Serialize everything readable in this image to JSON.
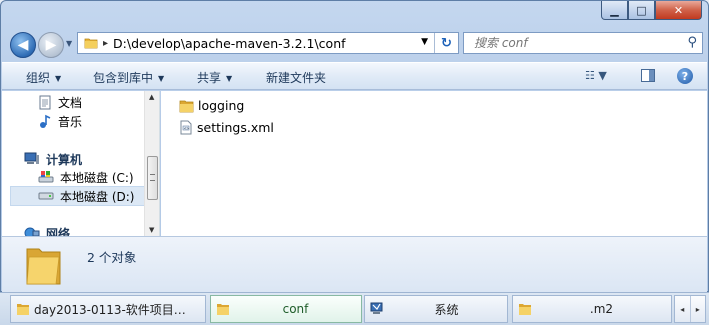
{
  "window": {
    "minimize_glyph": "▁",
    "maximize_glyph": "□",
    "close_glyph": "✕"
  },
  "address": {
    "path": "D:\\develop\\apache-maven-3.2.1\\conf",
    "search_placeholder": "搜索 conf"
  },
  "toolbar": {
    "organize": "组织",
    "include_in_library": "包含到库中",
    "share": "共享",
    "new_folder": "新建文件夹"
  },
  "navpane": {
    "items": [
      {
        "label": "文档",
        "icon": "documents-icon"
      },
      {
        "label": "音乐",
        "icon": "music-icon"
      },
      {
        "label": "计算机",
        "icon": "computer-icon"
      },
      {
        "label": "本地磁盘 (C:)",
        "icon": "drive-c-icon"
      },
      {
        "label": "本地磁盘 (D:)",
        "icon": "drive-d-icon"
      },
      {
        "label": "网络",
        "icon": "network-icon"
      }
    ]
  },
  "files": [
    {
      "name": "logging",
      "type": "folder"
    },
    {
      "name": "settings.xml",
      "type": "xml-file"
    }
  ],
  "details": {
    "count_text": "2 个对象"
  },
  "taskbar": {
    "items": [
      {
        "label": "day2013-0113-软件项目…"
      },
      {
        "label": "conf"
      },
      {
        "label": "系统"
      },
      {
        "label": ".m2"
      }
    ]
  },
  "colors": {
    "frame": "#b6cbe7",
    "close_button": "#c94a30",
    "selection": "#dce8f5",
    "text": "#1e395b"
  }
}
